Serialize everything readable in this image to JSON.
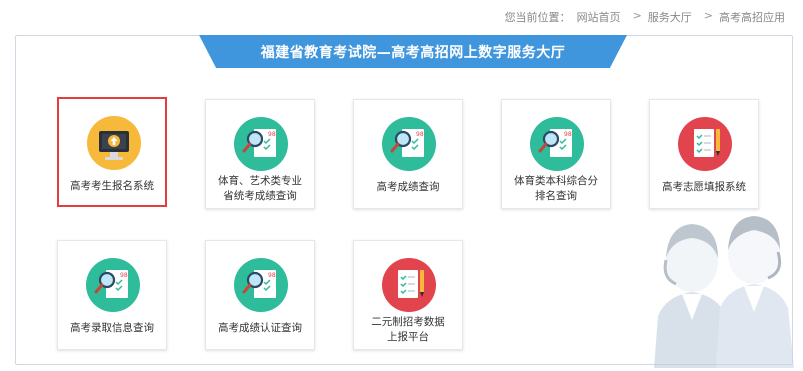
{
  "breadcrumb": {
    "prefix": "您当前位置：",
    "items": [
      "网站首页",
      "服务大厅",
      "高考高招应用"
    ]
  },
  "banner": {
    "title": "福建省教育考试院—高考高招网上数字服务大厅"
  },
  "services": [
    {
      "label": "高考考生报名系统",
      "icon": "computer-upload-icon",
      "color": "#f6b93a",
      "selected": true
    },
    {
      "label": "体育、艺术类专业\n省统考成绩查询",
      "icon": "score-search-icon",
      "color": "#2fbc9a"
    },
    {
      "label": "高考成绩查询",
      "icon": "score-search-icon",
      "color": "#2fbc9a"
    },
    {
      "label": "体育类本科综合分\n排名查询",
      "icon": "score-search-icon",
      "color": "#2fbc9a"
    },
    {
      "label": "高考志愿填报系统",
      "icon": "checklist-pencil-icon",
      "color": "#e2444d"
    },
    {
      "label": "高考录取信息查询",
      "icon": "score-search-icon",
      "color": "#2fbc9a"
    },
    {
      "label": "高考成绩认证查询",
      "icon": "score-search-icon",
      "color": "#2fbc9a"
    },
    {
      "label": "二元制招考数据\n上报平台",
      "icon": "checklist-pencil-icon",
      "color": "#e2444d"
    }
  ],
  "colors": {
    "accent": "#3f96dd",
    "selection": "#e23c3c"
  }
}
